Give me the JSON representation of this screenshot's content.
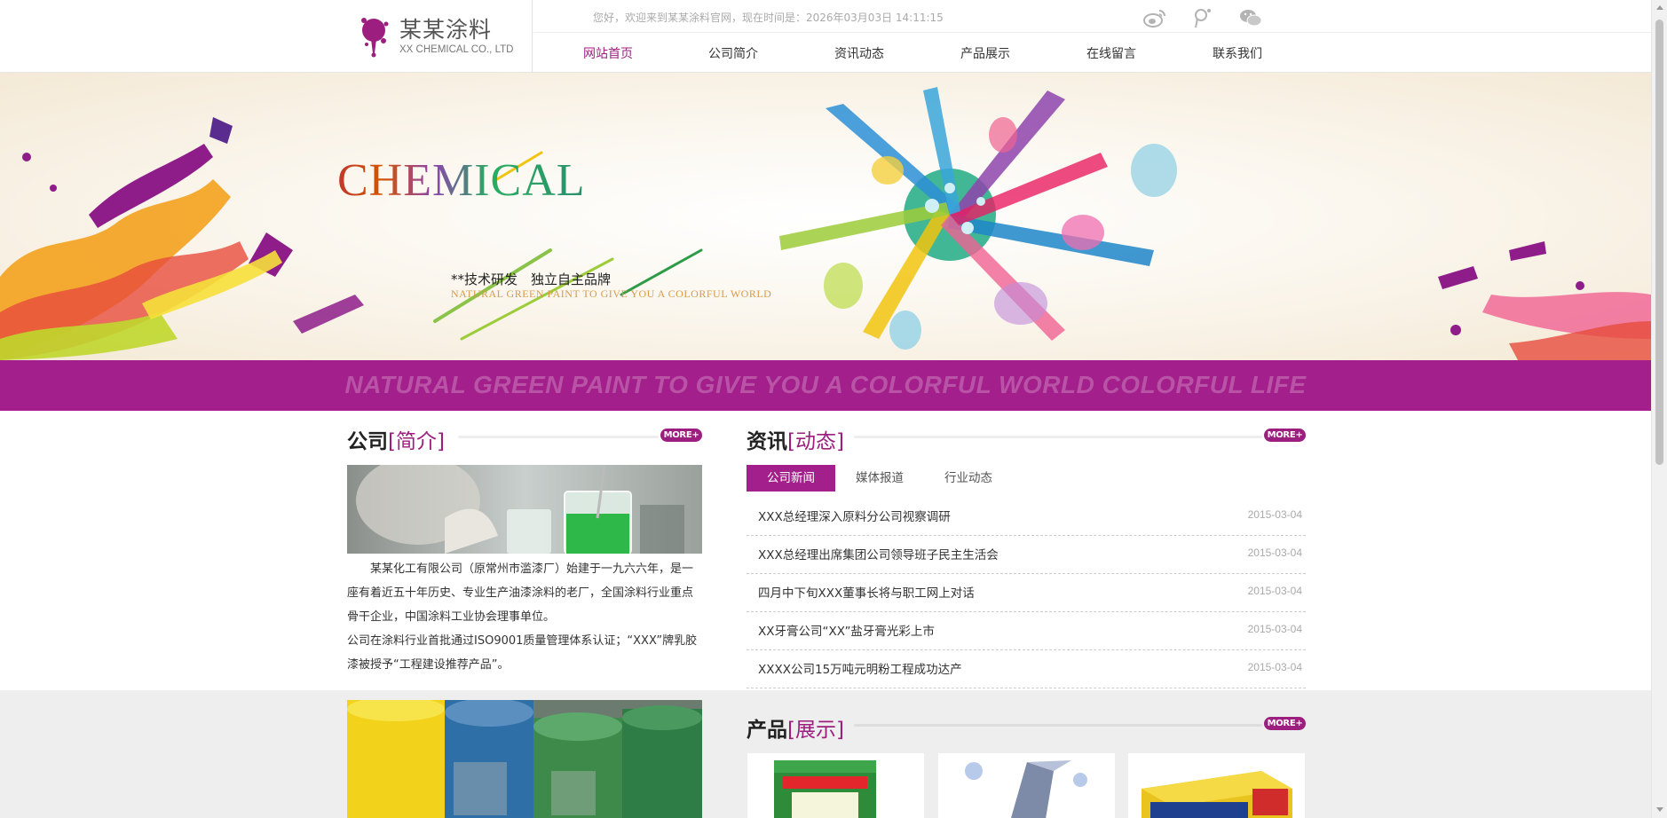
{
  "header": {
    "logo_cn": "某某涂料",
    "logo_en": "XX CHEMICAL CO., LTD",
    "welcome": "您好，欢迎来到某某涂料官网，现在时间是：2026年03月03日 14:11:15",
    "social_icons": [
      "weibo-icon",
      "tencent-weibo-icon",
      "wechat-icon"
    ]
  },
  "nav": {
    "items": [
      {
        "label": "网站首页",
        "active": true
      },
      {
        "label": "公司简介",
        "active": false
      },
      {
        "label": "资讯动态",
        "active": false
      },
      {
        "label": "产品展示",
        "active": false
      },
      {
        "label": "在线留言",
        "active": false
      },
      {
        "label": "联系我们",
        "active": false
      }
    ]
  },
  "banner": {
    "title": "CHEMICAL",
    "subtitle": "**技术研发　独立自主品牌",
    "subtitle_en": "NATURAL GREEN PAINT TO GIVE YOU A COLORFUL WORLD",
    "strip_text": "NATURAL GREEN PAINT TO GIVE YOU A COLORFUL WORLD COLORFUL LIFE"
  },
  "about": {
    "title_main": "公司",
    "title_accent": "[简介]",
    "more": "MORE+",
    "paragraph1": "　　某某化工有限公司（原常州市滥漆厂）始建于一九六六年，是一座有着近五十年历史、专业生产油漆涂料的老厂，全国涂料行业重点骨干企业，中国涂料工业协会理事单位。",
    "paragraph2": "公司在涂料行业首批通过ISO9001质量管理体系认证；“XXX”牌乳胶漆被授予“工程建设推荐产品”。"
  },
  "news": {
    "title_main": "资讯",
    "title_accent": "[动态]",
    "more": "MORE+",
    "tabs": [
      {
        "label": "公司新闻",
        "active": true
      },
      {
        "label": "媒体报道",
        "active": false
      },
      {
        "label": "行业动态",
        "active": false
      }
    ],
    "items": [
      {
        "title": "XXX总经理深入原料分公司视察调研",
        "date": "2015-03-04"
      },
      {
        "title": "XXX总经理出席集团公司领导班子民主生活会",
        "date": "2015-03-04"
      },
      {
        "title": "四月中下旬XXX董事长将与职工网上对话",
        "date": "2015-03-04"
      },
      {
        "title": "XX牙膏公司“XX”盐牙膏光彩上市",
        "date": "2015-03-04"
      },
      {
        "title": "XXXX公司15万吨元明粉工程成功达产",
        "date": "2015-03-04"
      }
    ]
  },
  "products": {
    "title_main": "产品",
    "title_accent": "[展示]",
    "more": "MORE+"
  },
  "colors": {
    "brand": "#9c1f7f",
    "strip": "#a21f8c",
    "gray_band": "#eeeeee"
  }
}
